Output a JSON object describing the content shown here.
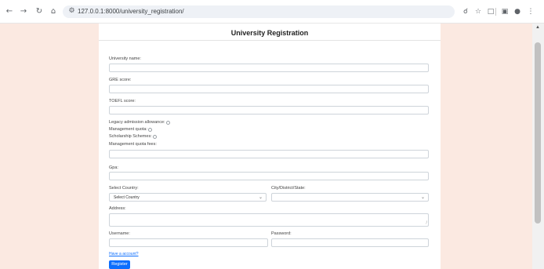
{
  "browser": {
    "url": "127.0.0.1:8000/university_registration/",
    "back_icon": "arrow-left",
    "forward_icon": "arrow-right",
    "reload_icon": "reload",
    "home_icon": "home",
    "site_info_icon": "site-info",
    "right_icons": [
      "zoom",
      "star",
      "extensions",
      "sidebar",
      "profile",
      "menu"
    ]
  },
  "page": {
    "title": "University Registration",
    "fields": {
      "university_name": {
        "label": "University name:",
        "value": ""
      },
      "gre_score": {
        "label": "GRE score:",
        "value": ""
      },
      "toefl_score": {
        "label": "TOEFL score:",
        "value": ""
      },
      "management_quota_fees": {
        "label": "Management quota fees:",
        "value": ""
      },
      "gpa": {
        "label": "Gpa:",
        "value": ""
      },
      "address": {
        "label": "Address:",
        "value": ""
      },
      "username": {
        "label": "Username:",
        "value": ""
      },
      "password": {
        "label": "Password:",
        "value": ""
      }
    },
    "checkboxes": {
      "legacy": "Legacy admission allowance:",
      "management": "Management quota:",
      "scholarship": "Scholarship Schemes:"
    },
    "country": {
      "label": "Select Country:",
      "selected": "Select Country"
    },
    "city": {
      "label": "City/District/State:",
      "selected": ""
    },
    "have_account_link": "Have a account?",
    "register_button": "Register"
  },
  "colors": {
    "page_background": "#fbe9e1",
    "primary_button": "#0d6efd"
  }
}
